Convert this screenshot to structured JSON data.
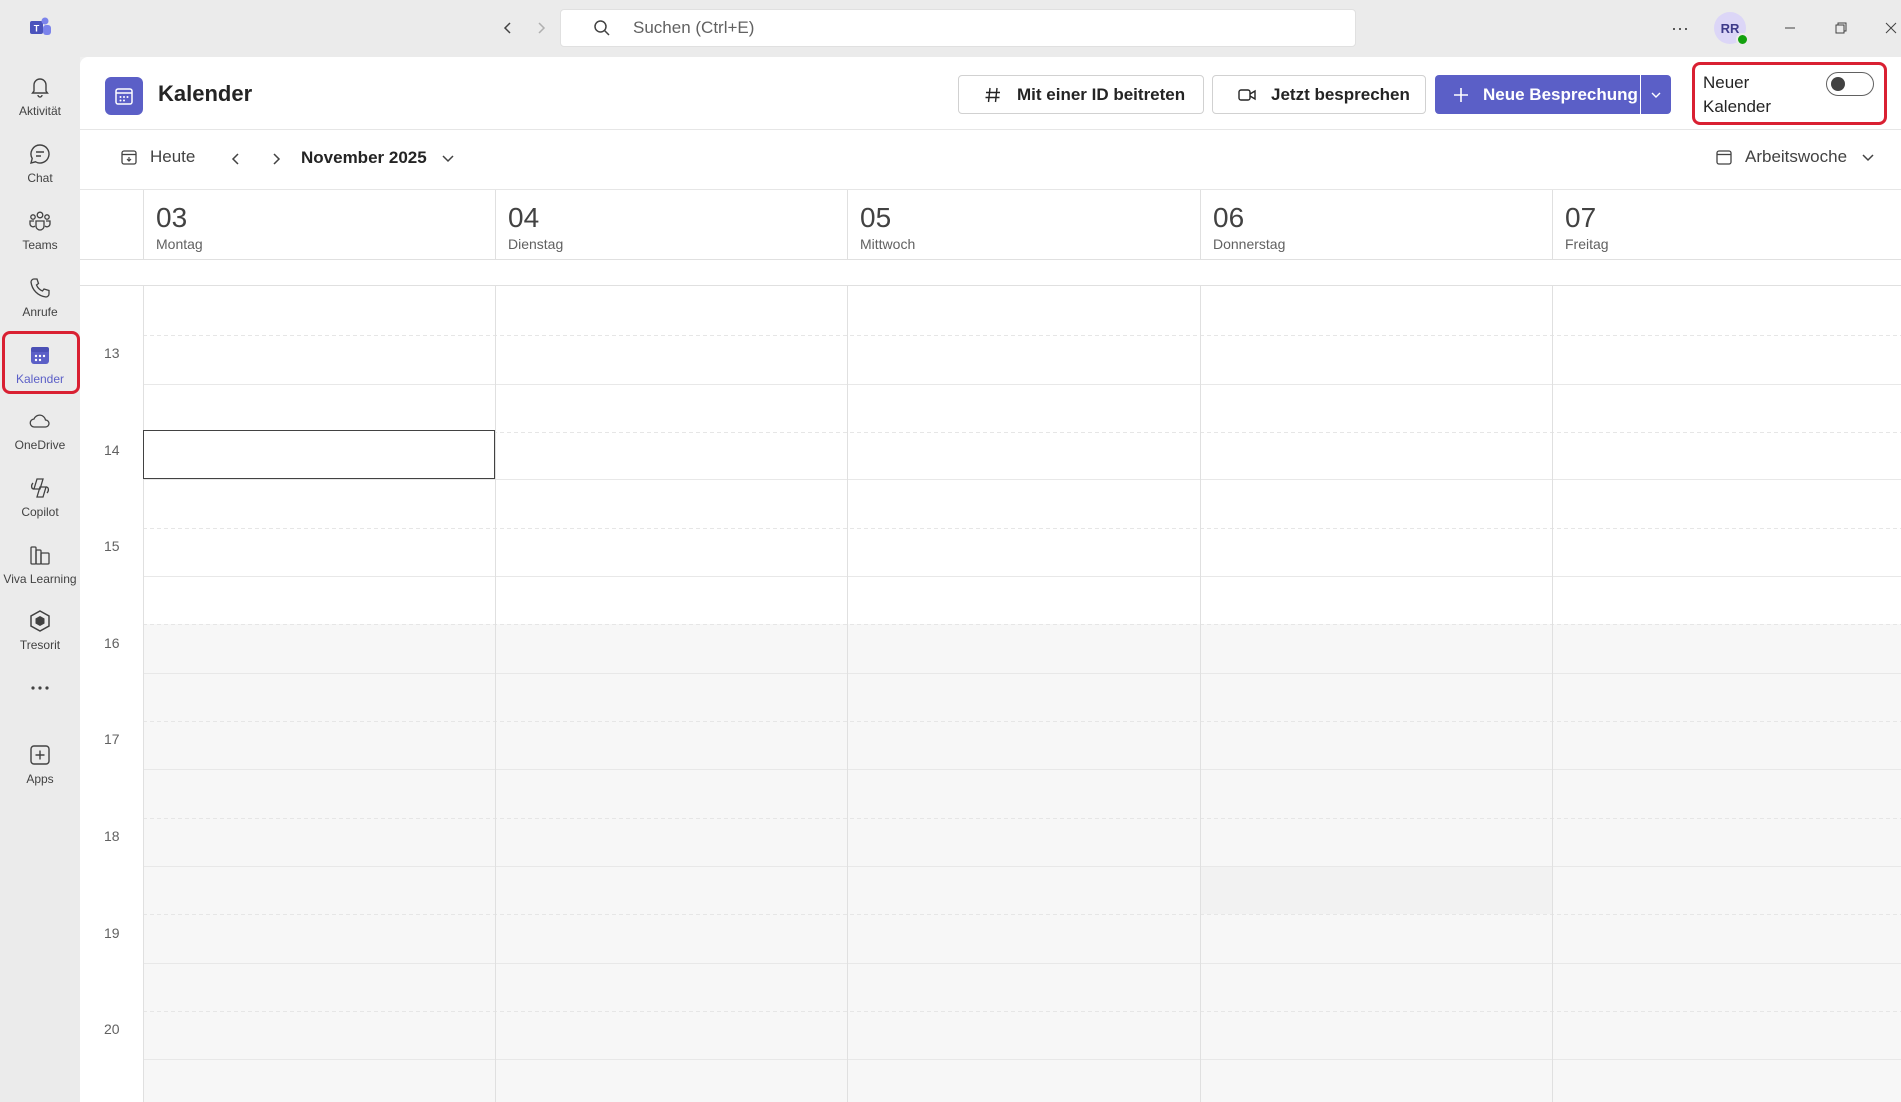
{
  "titlebar": {
    "search_placeholder": "Suchen (Ctrl+E)",
    "avatar_initials": "RR",
    "more_label": "···"
  },
  "rail": {
    "items": [
      {
        "label": "Aktivität",
        "icon": "bell-icon"
      },
      {
        "label": "Chat",
        "icon": "chat-icon"
      },
      {
        "label": "Teams",
        "icon": "teams-icon"
      },
      {
        "label": "Anrufe",
        "icon": "phone-icon"
      },
      {
        "label": "Kalender",
        "icon": "calendar-icon",
        "active": true
      },
      {
        "label": "OneDrive",
        "icon": "cloud-icon"
      },
      {
        "label": "Copilot",
        "icon": "copilot-icon"
      },
      {
        "label": "Viva Learning",
        "icon": "books-icon"
      },
      {
        "label": "Tresorit",
        "icon": "cube-icon"
      },
      {
        "label": "",
        "icon": "more-icon"
      },
      {
        "label": "Apps",
        "icon": "add-app-icon"
      }
    ]
  },
  "header": {
    "title": "Kalender",
    "join_id_label": "Mit einer ID beitreten",
    "meet_now_label": "Jetzt besprechen",
    "new_meeting_label": "Neue Besprechung",
    "new_calendar_label": "Neuer Kalender",
    "new_calendar_toggle": false
  },
  "toolbar": {
    "today_label": "Heute",
    "month_label": "November 2025",
    "view_label": "Arbeitswoche"
  },
  "days": [
    {
      "num": "03",
      "name": "Montag"
    },
    {
      "num": "04",
      "name": "Dienstag"
    },
    {
      "num": "05",
      "name": "Mittwoch"
    },
    {
      "num": "06",
      "name": "Donnerstag"
    },
    {
      "num": "07",
      "name": "Freitag"
    }
  ],
  "hours": [
    "13",
    "14",
    "15",
    "16",
    "17",
    "18",
    "19",
    "20"
  ],
  "colors": {
    "accent": "#5b5fc7",
    "highlight": "#d92032",
    "presence": "#13a10e"
  }
}
